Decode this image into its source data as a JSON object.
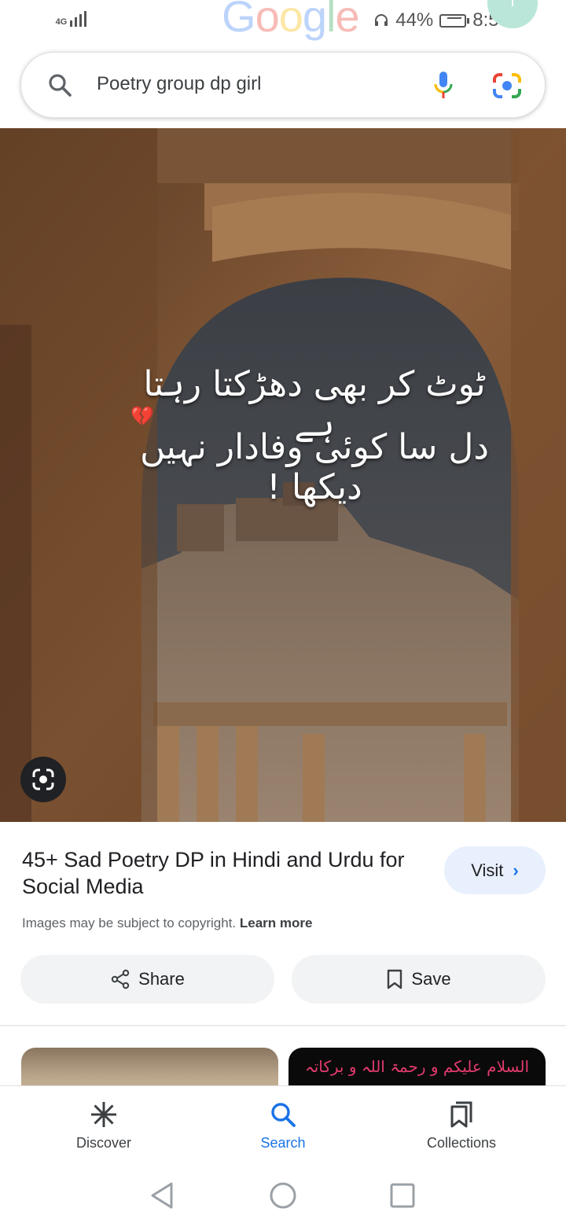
{
  "status_bar": {
    "network": "4G",
    "battery_percent": "44%",
    "time": "8:59",
    "avatar_initial": "I"
  },
  "logo": {
    "letters": [
      "G",
      "o",
      "o",
      "g",
      "l",
      "e"
    ]
  },
  "search": {
    "query": "Poetry group dp girl"
  },
  "hero": {
    "quote_line_1": "ٹوٹ کر بھی دھڑکتا رہتا ہے",
    "quote_line_2": "دل سا کوئی وفادار نہیں دیکھا !"
  },
  "result": {
    "title": "45+ Sad Poetry DP in Hindi and Urdu for Social Media",
    "visit_label": "Visit",
    "copyright_text": "Images may be subject to copyright.",
    "learn_more": "Learn more",
    "share_label": "Share",
    "save_label": "Save"
  },
  "thumbnails": {
    "right_text": "السلام علیکم و رحمۃ اللہ و برکاتہ"
  },
  "bottom_nav": {
    "items": [
      {
        "label": "Discover",
        "icon": "asterisk-icon"
      },
      {
        "label": "Search",
        "icon": "search-icon"
      },
      {
        "label": "Collections",
        "icon": "collections-icon"
      }
    ]
  },
  "colors": {
    "accent": "#1a73e8",
    "visit_bg": "#e8f0fe",
    "button_bg": "#f1f3f4"
  }
}
